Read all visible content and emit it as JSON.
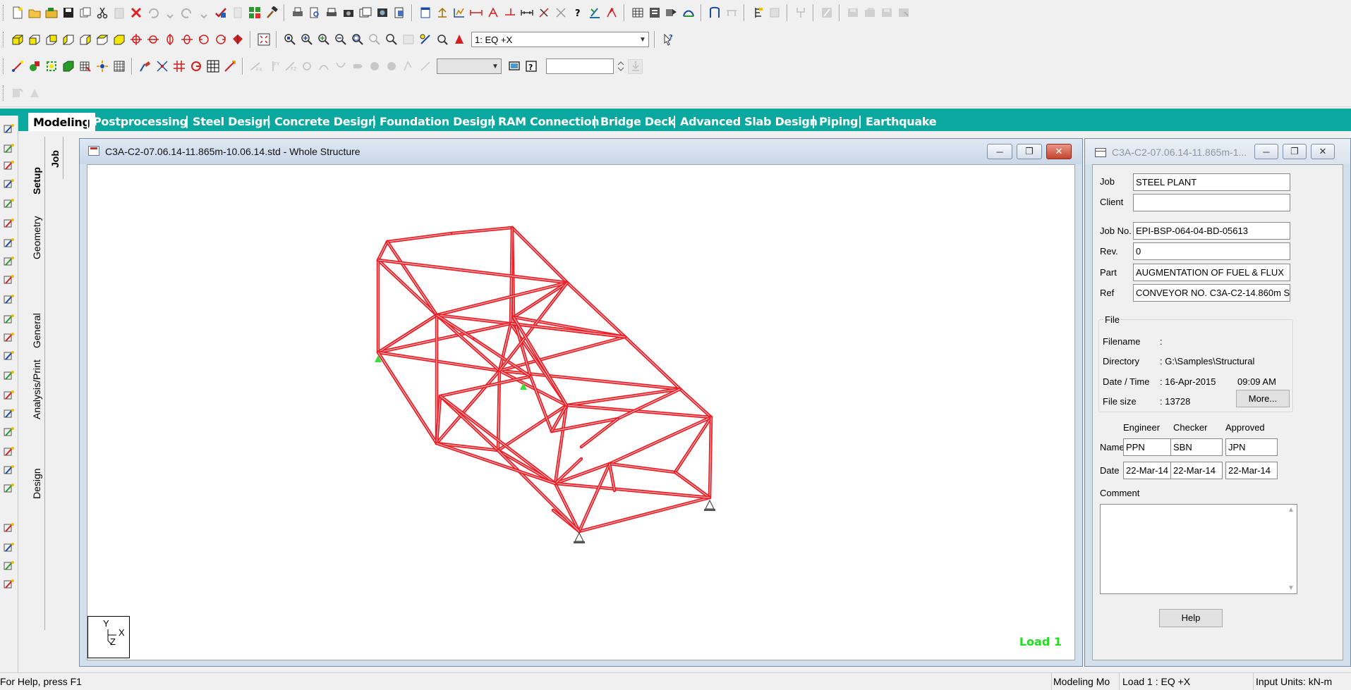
{
  "toolbar": {
    "load_case_combo": "1: EQ +X",
    "icons_row1": [
      "new-file-icon",
      "open-folder-icon",
      "open-project-icon",
      "save-icon",
      "save-as-icon",
      "cut-icon",
      "paste-icon",
      "delete-icon",
      "undo-icon",
      "undo-list-icon",
      "redo-icon",
      "redo-list-icon",
      "check-icon",
      "clipboard-icon",
      "structure-wizard-icon",
      "hammer-icon",
      "print-icon",
      "print-preview-icon",
      "print-current-icon",
      "snapshot-icon",
      "camera-icon",
      "report-icon",
      "report-setup-icon",
      "page-setup-icon",
      "window-icon",
      "dimension-icon",
      "node-tag-icon",
      "beam-spec-icon",
      "display-node-icon",
      "measure-icon",
      "tag-off-icon",
      "help-pointer-icon",
      "labels-icon",
      "error-icon",
      "table-icon",
      "grid-icon",
      "run-icon",
      "analysis-icon",
      "arch-icon",
      "bridge-icon",
      "stair-icon",
      "floor-icon",
      "plug-icon",
      "export-icon",
      "import-icon",
      "save-view-icon",
      "restore-view-icon",
      "delete-view-icon"
    ],
    "icons_row2": [
      "iso-view-icon",
      "front-view-icon",
      "back-view-icon",
      "left-view-icon",
      "right-view-icon",
      "top-view-icon",
      "rotate-up-icon",
      "rotate-down-icon",
      "rotate-left-icon",
      "rotate-right-icon",
      "spin-left-icon",
      "spin-right-icon",
      "3d-rotate-icon",
      "display-options-icon",
      "zoom-extents-icon",
      "zoom-in-icon",
      "zoom-out-icon",
      "zoom-window-icon",
      "zoom-dynamic-icon",
      "zoom-previous-icon",
      "pan-icon",
      "magnifier-icon",
      "perspective-icon",
      "help-icon"
    ],
    "icons_row3": [
      "nodes-cursor-icon",
      "beams-cursor-icon",
      "plates-cursor-icon",
      "solids-cursor-icon",
      "surfaces-cursor-icon",
      "geometry-cursor-icon",
      "all-cursor-icon",
      "snap-grid-icon",
      "add-beam-icon",
      "add-plate-icon",
      "add-solid-icon",
      "circle-icon",
      "grid-node-icon",
      "section-icon",
      "fx-icon",
      "fy-icon",
      "fz-icon",
      "mx-icon",
      "my-icon",
      "mz-icon",
      "force-icon",
      "moment-icon",
      "reaction-icon",
      "displacement-icon",
      "stress-icon",
      "monitor-icon",
      "query-icon",
      "up-down-icon"
    ],
    "icons_row4": [
      "property-icon",
      "assign-icon"
    ]
  },
  "tabs": [
    "Modeling",
    "Postprocessing",
    "Steel Design",
    "Concrete Design",
    "Foundation Design",
    "RAM Connection",
    "Bridge Deck",
    "Advanced Slab Design",
    "Piping",
    "Earthquake"
  ],
  "side_tabs_outer": [
    "Setup",
    "Geometry",
    "General",
    "Analysis/Print",
    "Design"
  ],
  "side_tab_inner": "Job",
  "main_window": {
    "title": "C3A-C2-07.06.14-11.865m-10.06.14.std - Whole Structure",
    "load_label": "Load 1",
    "axis": {
      "y": "Y",
      "x": "X",
      "z": "Z"
    }
  },
  "job_panel": {
    "title": "C3A-C2-07.06.14-11.865m-1...",
    "fields": {
      "job_label": "Job",
      "job": "STEEL PLANT",
      "client_label": "Client",
      "client": "",
      "jobno_label": "Job No.",
      "jobno": "EPI-BSP-064-04-BD-05613",
      "rev_label": "Rev.",
      "rev": "0",
      "part_label": "Part",
      "part": "AUGMENTATION OF FUEL & FLUX",
      "ref_label": "Ref",
      "ref": "CONVEYOR NO. C3A-C2-14.860m S"
    },
    "file": {
      "group_label": "File",
      "filename_label": "Filename",
      "filename": ":",
      "directory_label": "Directory",
      "directory": ": G:\\Samples\\Structural",
      "datetime_label": "Date / Time",
      "date": ": 16-Apr-2015",
      "time": "09:09 AM",
      "filesize_label": "File size",
      "filesize": ": 13728",
      "more_button": "More..."
    },
    "signoff": {
      "engineer_label": "Engineer",
      "checker_label": "Checker",
      "approved_label": "Approved",
      "name_label": "Name",
      "date_label": "Date",
      "engineer_name": "PPN",
      "checker_name": "SBN",
      "approved_name": "JPN",
      "engineer_date": "22-Mar-14",
      "checker_date": "22-Mar-14",
      "approved_date": "22-Mar-14"
    },
    "comment_label": "Comment",
    "comment": "",
    "help_button": "Help"
  },
  "status_bar": {
    "help": "For Help, press F1",
    "mode": "Modeling Mo",
    "load": "Load 1 : EQ +X",
    "units": "Input Units:   kN-m"
  },
  "colors": {
    "tab_bar": "#0aa89f",
    "structure": "#ee1c25",
    "support": "#3cdc3c",
    "load_label": "#22dd22"
  }
}
